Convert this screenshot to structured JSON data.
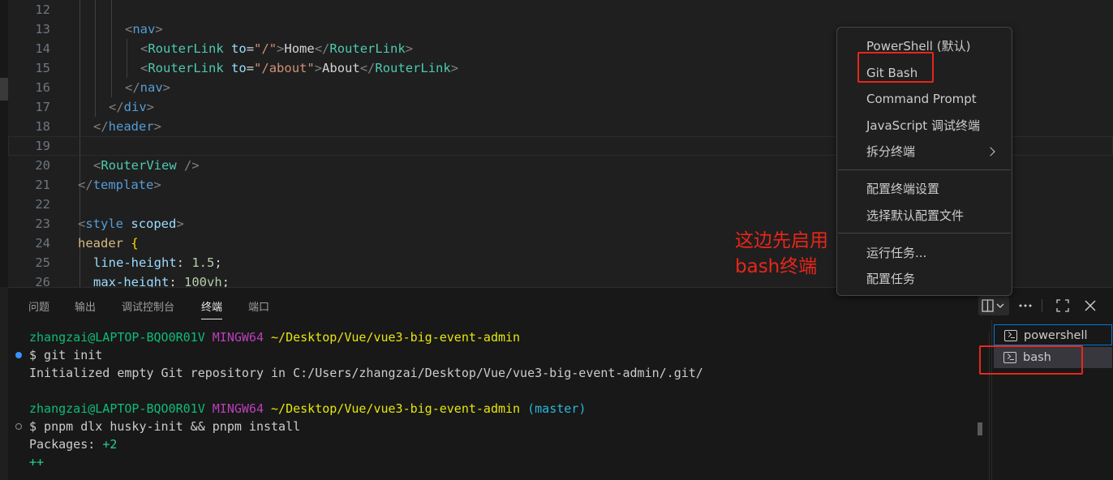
{
  "editor": {
    "lines": [
      {
        "n": "12",
        "tokens": []
      },
      {
        "n": "13",
        "tokens": [
          [
            "t-tag",
            "<"
          ],
          [
            "t-name",
            "nav"
          ],
          [
            "t-tag",
            ">"
          ]
        ]
      },
      {
        "n": "14",
        "tokens": [
          [
            "t-tag",
            "<"
          ],
          [
            "t-comp",
            "RouterLink"
          ],
          [
            "t-text",
            " "
          ],
          [
            "t-attr",
            "to"
          ],
          [
            "t-text",
            "="
          ],
          [
            "t-str",
            "\"/\""
          ],
          [
            "t-tag",
            ">"
          ],
          [
            "t-text",
            "Home"
          ],
          [
            "t-tag",
            "</"
          ],
          [
            "t-comp",
            "RouterLink"
          ],
          [
            "t-tag",
            ">"
          ]
        ]
      },
      {
        "n": "15",
        "tokens": [
          [
            "t-tag",
            "<"
          ],
          [
            "t-comp",
            "RouterLink"
          ],
          [
            "t-text",
            " "
          ],
          [
            "t-attr",
            "to"
          ],
          [
            "t-text",
            "="
          ],
          [
            "t-str",
            "\"/about\""
          ],
          [
            "t-tag",
            ">"
          ],
          [
            "t-text",
            "About"
          ],
          [
            "t-tag",
            "</"
          ],
          [
            "t-comp",
            "RouterLink"
          ],
          [
            "t-tag",
            ">"
          ]
        ]
      },
      {
        "n": "16",
        "tokens": [
          [
            "t-tag",
            "</"
          ],
          [
            "t-name",
            "nav"
          ],
          [
            "t-tag",
            ">"
          ]
        ]
      },
      {
        "n": "17",
        "tokens": [
          [
            "t-tag",
            "</"
          ],
          [
            "t-name",
            "div"
          ],
          [
            "t-tag",
            ">"
          ]
        ]
      },
      {
        "n": "18",
        "tokens": [
          [
            "t-tag",
            "</"
          ],
          [
            "t-name",
            "header"
          ],
          [
            "t-tag",
            ">"
          ]
        ]
      },
      {
        "n": "19",
        "tokens": []
      },
      {
        "n": "20",
        "tokens": [
          [
            "t-tag",
            "<"
          ],
          [
            "t-comp",
            "RouterView"
          ],
          [
            "t-text",
            " "
          ],
          [
            "t-tag",
            "/>"
          ]
        ]
      },
      {
        "n": "21",
        "tokens": [
          [
            "t-tag",
            "</"
          ],
          [
            "t-name",
            "template"
          ],
          [
            "t-tag",
            ">"
          ]
        ]
      },
      {
        "n": "22",
        "tokens": []
      },
      {
        "n": "23",
        "tokens": [
          [
            "t-tag",
            "<"
          ],
          [
            "t-name",
            "style"
          ],
          [
            "t-text",
            " "
          ],
          [
            "t-attr",
            "scoped"
          ],
          [
            "t-tag",
            ">"
          ]
        ]
      },
      {
        "n": "24",
        "tokens": [
          [
            "t-sel",
            "header"
          ],
          [
            "t-text",
            " "
          ],
          [
            "t-brace",
            "{"
          ]
        ]
      },
      {
        "n": "25",
        "tokens": [
          [
            "t-prop",
            "line-height"
          ],
          [
            "t-text",
            ": "
          ],
          [
            "t-num",
            "1.5"
          ],
          [
            "t-text",
            ";"
          ]
        ]
      },
      {
        "n": "26",
        "tokens": [
          [
            "t-prop",
            "max-height"
          ],
          [
            "t-text",
            ": "
          ],
          [
            "t-num",
            "100vh"
          ],
          [
            "t-text",
            ";"
          ]
        ]
      }
    ]
  },
  "panel": {
    "tabs": {
      "problems": "问题",
      "output": "输出",
      "debug_console": "调试控制台",
      "terminal": "终端",
      "ports": "端口"
    },
    "terminal_lines": [
      [
        [
          "c-user",
          "zhangzai@LAPTOP-BQO0R01V"
        ],
        [
          "c-text",
          " "
        ],
        [
          "c-host",
          "MINGW64"
        ],
        [
          "c-text",
          " "
        ],
        [
          "c-path",
          "~/Desktop/Vue/vue3-big-event-admin"
        ]
      ],
      [
        [
          "c-text",
          "$ git init"
        ]
      ],
      [
        [
          "c-text",
          "Initialized empty Git repository in C:/Users/zhangzai/Desktop/Vue/vue3-big-event-admin/.git/"
        ]
      ],
      [],
      [
        [
          "c-user",
          "zhangzai@LAPTOP-BQO0R01V"
        ],
        [
          "c-text",
          " "
        ],
        [
          "c-host",
          "MINGW64"
        ],
        [
          "c-text",
          " "
        ],
        [
          "c-path",
          "~/Desktop/Vue/vue3-big-event-admin"
        ],
        [
          "c-text",
          " "
        ],
        [
          "c-branch",
          "(master)"
        ]
      ],
      [
        [
          "c-text",
          "$ pnpm dlx husky-init && pnpm install"
        ]
      ],
      [
        [
          "c-text",
          "Packages: "
        ],
        [
          "c-plus",
          "+2"
        ]
      ],
      [
        [
          "c-plus",
          "++"
        ]
      ]
    ],
    "terminal_list": [
      {
        "label": "powershell"
      },
      {
        "label": "bash"
      }
    ]
  },
  "dropdown_menu": {
    "items_group1": [
      "PowerShell (默认)",
      "Git Bash",
      "Command Prompt",
      "JavaScript 调试终端",
      "拆分终端"
    ],
    "items_group2": [
      "配置终端设置",
      "选择默认配置文件"
    ],
    "items_group3": [
      "运行任务...",
      "配置任务"
    ]
  },
  "annotation": {
    "line1": "这边先启用",
    "line2": "bash终端",
    "color": "#e8261a"
  },
  "icons": [
    "layout-split-icon",
    "chevron-down-icon",
    "more-icon",
    "maximize-icon",
    "close-icon",
    "terminal-icon",
    "chevron-right-icon"
  ]
}
